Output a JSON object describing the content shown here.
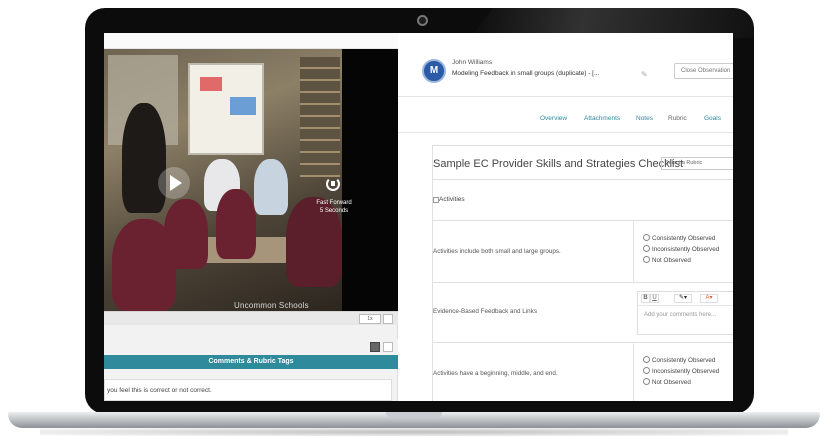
{
  "video": {
    "watermark": "Uncommon Schools",
    "fast_forward_title": "Fast Forward",
    "fast_forward_seconds": "5 Seconds",
    "speed": "1x"
  },
  "comments": {
    "header": "Comments & Rubric Tags",
    "text": "you feel this is correct or not correct."
  },
  "observation": {
    "author": "John Williams",
    "title": "Modeling Feedback in small groups (duplicate) - [...",
    "close_button": "Close Observation"
  },
  "tabs": [
    {
      "label": "Overview"
    },
    {
      "label": "Attachments"
    },
    {
      "label": "Notes"
    },
    {
      "label": "Rubric"
    },
    {
      "label": "Goals"
    }
  ],
  "rubric": {
    "title": "Sample EC Provider Skills and Strategies Checklist",
    "select_placeholder": "Select a Rubric",
    "section": "Activities",
    "rows": [
      {
        "label": "Activities include both small and large groups.",
        "options": [
          "Consistently Observed",
          "Inconsistently Observed",
          "Not Observed"
        ]
      },
      {
        "label": "Evidence-Based Feedback and Links",
        "editor_placeholder": "Add your comments here..."
      },
      {
        "label": "Activities have a beginning, middle, and end.",
        "options": [
          "Consistently Observed",
          "Inconsistently Observed",
          "Not Observed"
        ]
      }
    ]
  },
  "editor_toolbar": {
    "bold": "B",
    "underline": "U",
    "pen": "✎▾",
    "color": "A▾"
  },
  "colors": {
    "accent": "#2f8a9c",
    "avatar": "#2b5aa6"
  }
}
